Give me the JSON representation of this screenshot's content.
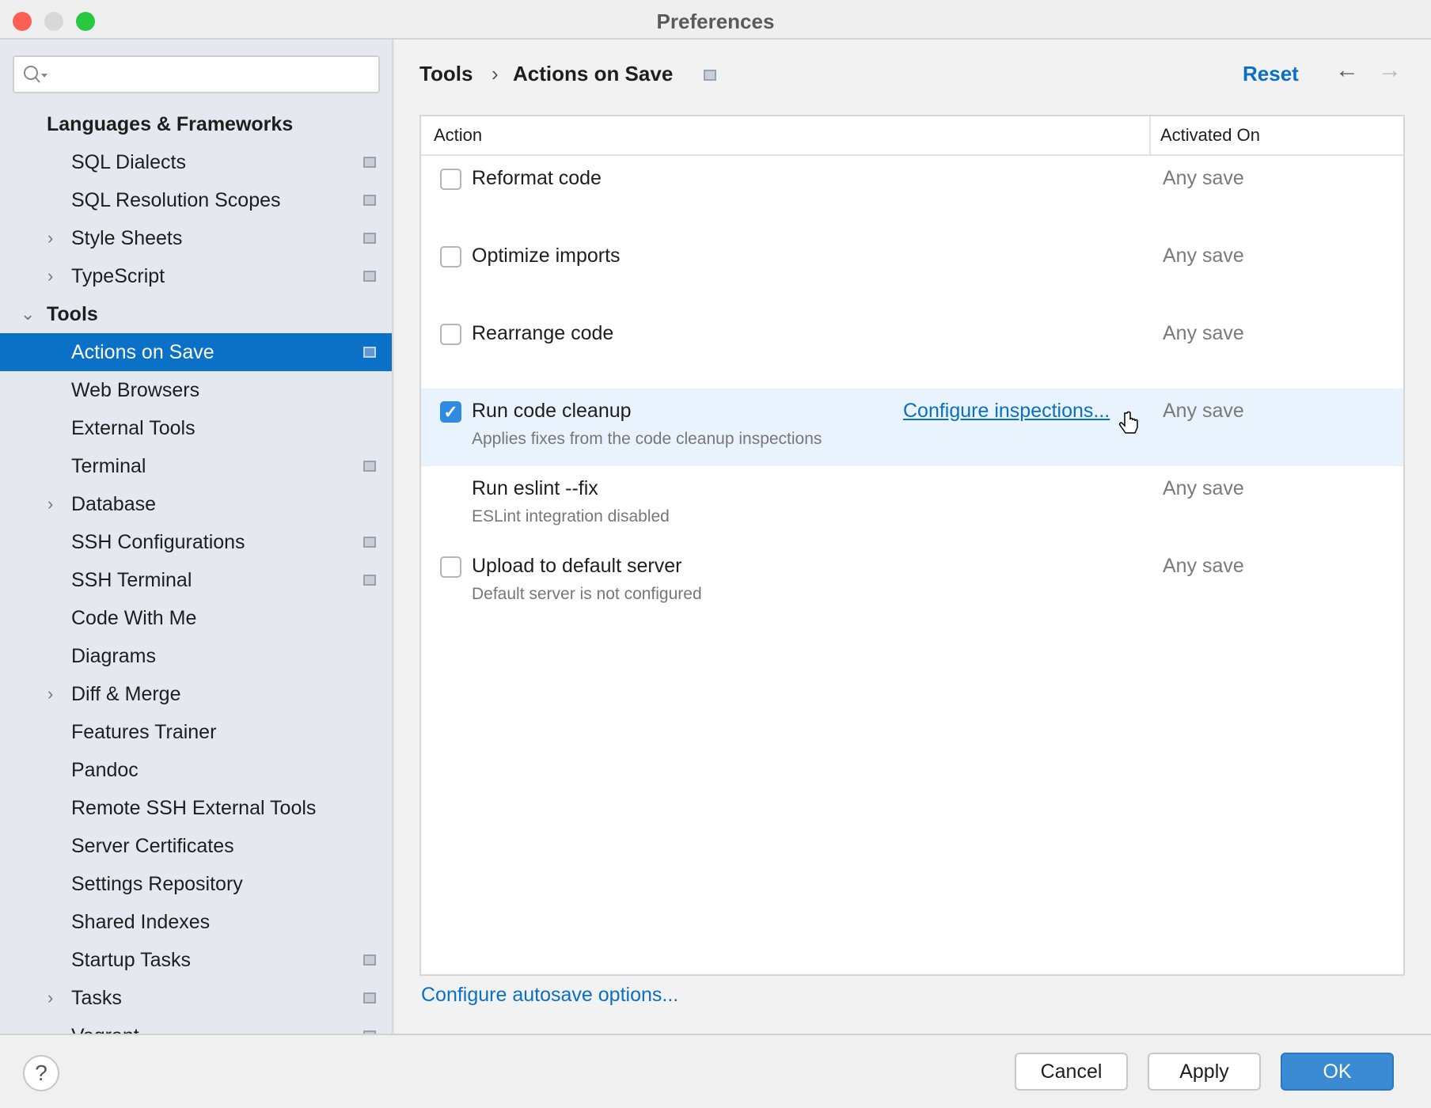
{
  "window": {
    "title": "Preferences"
  },
  "sidebar": {
    "search": {
      "value": "",
      "placeholder": ""
    },
    "items": [
      {
        "label": "Languages & Frameworks",
        "type": "group"
      },
      {
        "label": "SQL Dialects",
        "page_icon": true
      },
      {
        "label": "SQL Resolution Scopes",
        "page_icon": true
      },
      {
        "label": "Style Sheets",
        "expandable": true,
        "page_icon": true
      },
      {
        "label": "TypeScript",
        "expandable": true,
        "page_icon": true
      },
      {
        "label": "Tools",
        "type": "group",
        "expanded": true
      },
      {
        "label": "Actions on Save",
        "selected": true,
        "page_icon": true
      },
      {
        "label": "Web Browsers"
      },
      {
        "label": "External Tools"
      },
      {
        "label": "Terminal",
        "page_icon": true
      },
      {
        "label": "Database",
        "expandable": true
      },
      {
        "label": "SSH Configurations",
        "page_icon": true
      },
      {
        "label": "SSH Terminal",
        "page_icon": true
      },
      {
        "label": "Code With Me"
      },
      {
        "label": "Diagrams"
      },
      {
        "label": "Diff & Merge",
        "expandable": true
      },
      {
        "label": "Features Trainer"
      },
      {
        "label": "Pandoc"
      },
      {
        "label": "Remote SSH External Tools"
      },
      {
        "label": "Server Certificates"
      },
      {
        "label": "Settings Repository"
      },
      {
        "label": "Shared Indexes"
      },
      {
        "label": "Startup Tasks",
        "page_icon": true
      },
      {
        "label": "Tasks",
        "expandable": true,
        "page_icon": true
      },
      {
        "label": "Vagrant",
        "page_icon": true
      }
    ]
  },
  "header": {
    "breadcrumb": [
      "Tools",
      "Actions on Save"
    ],
    "separator": "›",
    "reset_label": "Reset"
  },
  "table": {
    "columns": [
      "Action",
      "Activated On"
    ],
    "rows": [
      {
        "label": "Reformat code",
        "checked": false,
        "activated_on": "Any save"
      },
      {
        "label": "Optimize imports",
        "checked": false,
        "activated_on": "Any save"
      },
      {
        "label": "Rearrange code",
        "checked": false,
        "activated_on": "Any save"
      },
      {
        "label": "Run code cleanup",
        "checked": true,
        "sub": "Applies fixes from the code cleanup inspections",
        "link": "Configure inspections...",
        "activated_on": "Any save",
        "hovered": true
      },
      {
        "label": "Run eslint --fix",
        "sub": "ESLint integration disabled",
        "activated_on": "Any save"
      },
      {
        "label": "Upload to default server",
        "checked": false,
        "sub": "Default server is not configured",
        "activated_on": "Any save"
      }
    ]
  },
  "autosave_link": "Configure autosave options...",
  "footer": {
    "help": "?",
    "cancel": "Cancel",
    "apply": "Apply",
    "ok": "OK"
  },
  "colors": {
    "accent": "#0a71c6",
    "link": "#0b6fc2",
    "ok_button": "#3a8ad4"
  }
}
